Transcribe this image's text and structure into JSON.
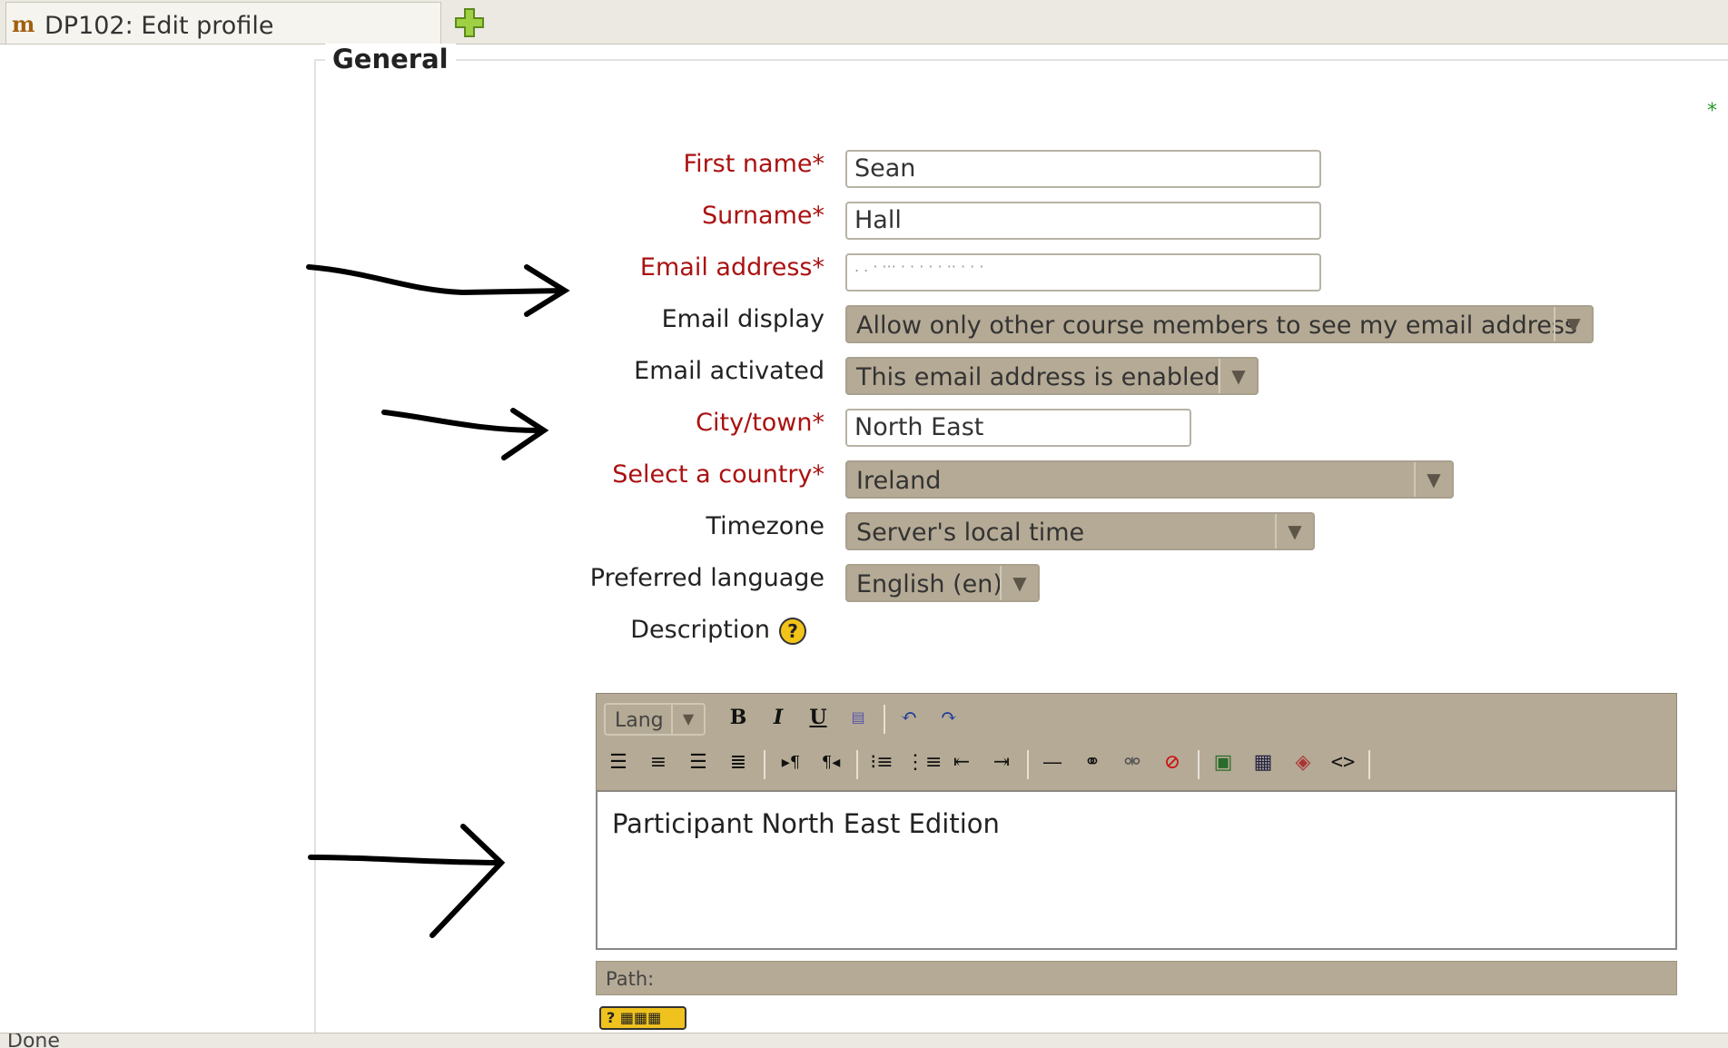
{
  "tab": {
    "title": "DP102: Edit profile",
    "icon_text": "m"
  },
  "fieldset": {
    "legend": "General"
  },
  "required_marker": "*",
  "form": {
    "first_name": {
      "label": "First name",
      "value": "Sean"
    },
    "surname": {
      "label": "Surname",
      "value": "Hall"
    },
    "email": {
      "label": "Email address",
      "value": ". .  ·  ··· · ·  ·  ·  ·  ·· ·  ·    ·"
    },
    "email_display": {
      "label": "Email display",
      "value": "Allow only other course members to see my email address"
    },
    "email_activated": {
      "label": "Email activated",
      "value": "This email address is enabled"
    },
    "city": {
      "label": "City/town",
      "value": "North East"
    },
    "country": {
      "label": "Select a country",
      "value": "Ireland"
    },
    "timezone": {
      "label": "Timezone",
      "value": "Server's local time"
    },
    "language": {
      "label": "Preferred language",
      "value": "English (en)"
    },
    "description": {
      "label": "Description",
      "help_icon": "?"
    }
  },
  "editor": {
    "lang_select": "Lang",
    "content": "Participant North East Edition",
    "path_label": "Path:",
    "toolbar_icons": [
      "bold-icon",
      "italic-icon",
      "underline-icon",
      "paste-word-icon",
      "undo-icon",
      "redo-icon",
      "align-left-icon",
      "align-center-icon",
      "align-right-icon",
      "justify-icon",
      "ltr-icon",
      "rtl-icon",
      "ordered-list-icon",
      "unordered-list-icon",
      "outdent-icon",
      "indent-icon",
      "horizontal-rule-icon",
      "link-icon",
      "unlink-icon",
      "nolink-icon",
      "image-icon",
      "table-icon",
      "insert-object-icon",
      "html-source-icon"
    ],
    "keyboard_icon_text": "?"
  },
  "status": {
    "text": "Done"
  },
  "colors": {
    "required": "#aa1111",
    "toolbar": "#b5aa95",
    "select_bg": "#b5aa95"
  }
}
